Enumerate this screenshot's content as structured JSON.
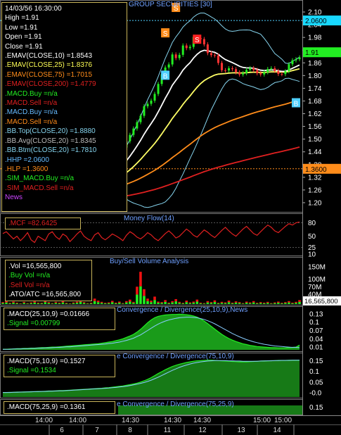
{
  "chart_data": [
    {
      "type": "candlestick",
      "title": "GROUP SECURITIES [30]",
      "ylim": [
        1.16,
        2.14
      ],
      "y_ticks": [
        "2.10",
        "2.04",
        "1.98",
        "1.92",
        "1.86",
        "1.80",
        "1.74",
        "1.68",
        "1.62",
        "1.56",
        "1.50",
        "1.44",
        "1.38",
        "1.32",
        "1.26",
        "1.20"
      ],
      "price_badges": {
        "bb_top_badge": "2.0600",
        "last_badge": "1.91",
        "hlp_badge": "1.3600"
      },
      "markers": [
        "S",
        "S",
        "S",
        "B",
        "B"
      ],
      "info": {
        "time_label": "14/03/56 16:30:00",
        "high_text": "High  =1.91",
        "low_text": "Low   =1.91",
        "open_text": "Open  =1.91",
        "close_text": "Close  =1.91",
        "ema10_text": ".EMAV(CLOSE,10)   =1.8543",
        "ema25_text": ".EMAV(CLOSE,25)  =1.8376",
        "ema75_text": ".EMAV(CLOSE,75)  =1.7015",
        "ema200_text": ".EMAV(CLOSE,200)  =1.4779",
        "macd_buy1_text": ".MACD.Buy    =n/a",
        "macd_sell1_text": ".MACD.Sell   =n/a",
        "macd_buy2_text": ".MACD.Buy    =n/a",
        "macd_sell2_text": ".MACD.Sell   =n/a",
        "bb_top_text": ".BB.Top(CLOSE,20)   =1.8880",
        "bb_avg_text": ".BB.Avg(CLOSE,20)   =1.8345",
        "bb_btm_text": ".BB.Btm(CLOSE,20)   =1.7810",
        "hhp_text": ".HHP    =2.0600",
        "hlp_text": ".HLP    =1.3600",
        "sim_buy_text": ".SIM_MACD.Buy    =n/a",
        "sim_sell_text": ".SIM_MACD.Sell    =n/a",
        "news_text": "News"
      },
      "colors": {
        "ema10": "#ffffff",
        "ema25": "#ffff66",
        "ema75": "#ff8c1a",
        "ema200": "#e02020",
        "bb": "#86d4ee",
        "candle": "#22ee22"
      }
    },
    {
      "type": "line",
      "title": "Money Flow(14)",
      "label_text": ".MCF  =82.6425",
      "ylim": [
        10,
        95
      ],
      "y_ticks": [
        "80",
        "50",
        "25",
        "10"
      ],
      "values": [
        56,
        60,
        52,
        44,
        50,
        40,
        48,
        58,
        42,
        36,
        50,
        45,
        40,
        55,
        60,
        49,
        43,
        55,
        50,
        38,
        46,
        55,
        62,
        50,
        44,
        40,
        53,
        58,
        47,
        42,
        48,
        55,
        51,
        46,
        40,
        52,
        60,
        55,
        48,
        44,
        50,
        58,
        53,
        45,
        40,
        48,
        56,
        62,
        55,
        46,
        50,
        58,
        66,
        60,
        52,
        48,
        56,
        64,
        59,
        52,
        47,
        55,
        63,
        70,
        62,
        55,
        50,
        58,
        66,
        72,
        64,
        56,
        52,
        60,
        68,
        75,
        70,
        62,
        58,
        65,
        72,
        78,
        75,
        80,
        82
      ]
    },
    {
      "type": "bar",
      "title": "Buy/Sell Volume Analysis",
      "last_value_badge": "16,565,800",
      "y_ticks": [
        "150M",
        "100M",
        "70M",
        "40M"
      ],
      "ylim": [
        0,
        170
      ],
      "info": {
        "vol_text": ".Vol    =16,565,800",
        "buy_text": ".Buy Vol   =n/a",
        "sell_text": ".Sell Vol   =n/a",
        "ato_text": ".ATO/ATC    =16,565,800"
      },
      "volumes": [
        8,
        12,
        5,
        10,
        6,
        3,
        9,
        4,
        7,
        11,
        6,
        5,
        14,
        8,
        4,
        9,
        6,
        12,
        5,
        3,
        7,
        10,
        16,
        8,
        4,
        6,
        22,
        14,
        9,
        5,
        7,
        13,
        6,
        10,
        4,
        12,
        18,
        9,
        70,
        130,
        60,
        22,
        14,
        30,
        10,
        8,
        16,
        6,
        12,
        20,
        9,
        5,
        14,
        7,
        10,
        18,
        6,
        4,
        12,
        8,
        15,
        5,
        9,
        7,
        14,
        6,
        11,
        8,
        4,
        10,
        7,
        12,
        5,
        8,
        6,
        9,
        4,
        7,
        10,
        5,
        8,
        12,
        6,
        9,
        16
      ]
    },
    {
      "type": "area",
      "title": "Convergence / Divergence(25,10,9),News",
      "ylim": [
        0,
        0.145
      ],
      "y_ticks": [
        "0.13",
        "0.1",
        "0.07",
        "0.04",
        "0.01"
      ],
      "info": {
        "macd_text": ".MACD(25,10,9)   =0.01666",
        "signal_text": ".Signal   =0.00799"
      },
      "macd": [
        0.002,
        0.002,
        0.003,
        0.003,
        0.004,
        0.004,
        0.005,
        0.005,
        0.006,
        0.006,
        0.007,
        0.008,
        0.008,
        0.009,
        0.01,
        0.01,
        0.011,
        0.012,
        0.013,
        0.014,
        0.015,
        0.016,
        0.017,
        0.018,
        0.019,
        0.02,
        0.021,
        0.022,
        0.024,
        0.026,
        0.028,
        0.03,
        0.033,
        0.036,
        0.04,
        0.045,
        0.05,
        0.056,
        0.064,
        0.074,
        0.086,
        0.098,
        0.108,
        0.116,
        0.121,
        0.124,
        0.126,
        0.127,
        0.128,
        0.128,
        0.129,
        0.128,
        0.127,
        0.125,
        0.122,
        0.118,
        0.112,
        0.104,
        0.095,
        0.085,
        0.075,
        0.065,
        0.056,
        0.048,
        0.041,
        0.035,
        0.03,
        0.026,
        0.022,
        0.019,
        0.016,
        0.014,
        0.012,
        0.011,
        0.01,
        0.009,
        0.008,
        0.008,
        0.007,
        0.007,
        0.007,
        0.008,
        0.009,
        0.01,
        0.017
      ],
      "signal": [
        0.002,
        0.002,
        0.002,
        0.003,
        0.003,
        0.003,
        0.004,
        0.004,
        0.005,
        0.005,
        0.006,
        0.006,
        0.007,
        0.007,
        0.008,
        0.009,
        0.009,
        0.01,
        0.011,
        0.011,
        0.012,
        0.013,
        0.014,
        0.015,
        0.016,
        0.017,
        0.018,
        0.019,
        0.02,
        0.021,
        0.023,
        0.024,
        0.026,
        0.028,
        0.031,
        0.034,
        0.038,
        0.042,
        0.048,
        0.054,
        0.062,
        0.07,
        0.078,
        0.086,
        0.093,
        0.099,
        0.104,
        0.108,
        0.111,
        0.114,
        0.116,
        0.117,
        0.118,
        0.118,
        0.117,
        0.116,
        0.113,
        0.11,
        0.105,
        0.1,
        0.094,
        0.087,
        0.08,
        0.073,
        0.066,
        0.059,
        0.053,
        0.047,
        0.042,
        0.037,
        0.033,
        0.029,
        0.026,
        0.023,
        0.02,
        0.018,
        0.016,
        0.014,
        0.013,
        0.012,
        0.011,
        0.01,
        0.009,
        0.009,
        0.008
      ]
    },
    {
      "type": "area",
      "title": "e Convergence / Divergence(75,10,9)",
      "ylim": [
        -0.02,
        0.175
      ],
      "y_ticks": [
        "0.15",
        "0.1",
        "0.05",
        "-0.0"
      ],
      "info": {
        "macd_text": ".MACD(75,10,9)   =0.1527",
        "signal_text": ".Signal   =0.1534"
      },
      "macd": [
        0.001,
        0.001,
        0.002,
        0.002,
        0.003,
        0.003,
        0.004,
        0.004,
        0.005,
        0.005,
        0.006,
        0.006,
        0.007,
        0.008,
        0.008,
        0.009,
        0.01,
        0.01,
        0.011,
        0.012,
        0.013,
        0.014,
        0.015,
        0.016,
        0.017,
        0.018,
        0.019,
        0.02,
        0.021,
        0.023,
        0.024,
        0.026,
        0.028,
        0.03,
        0.032,
        0.035,
        0.038,
        0.041,
        0.045,
        0.05,
        0.056,
        0.063,
        0.071,
        0.08,
        0.09,
        0.099,
        0.108,
        0.116,
        0.123,
        0.129,
        0.134,
        0.138,
        0.142,
        0.145,
        0.148,
        0.15,
        0.151,
        0.152,
        0.153,
        0.153,
        0.152,
        0.151,
        0.15,
        0.149,
        0.148,
        0.147,
        0.146,
        0.145,
        0.145,
        0.145,
        0.146,
        0.147,
        0.148,
        0.149,
        0.15,
        0.15,
        0.151,
        0.151,
        0.152,
        0.152,
        0.152,
        0.153,
        0.153,
        0.153,
        0.153
      ],
      "signal": [
        0.001,
        0.001,
        0.001,
        0.002,
        0.002,
        0.003,
        0.003,
        0.004,
        0.004,
        0.005,
        0.005,
        0.006,
        0.006,
        0.007,
        0.007,
        0.008,
        0.009,
        0.009,
        0.01,
        0.011,
        0.012,
        0.013,
        0.014,
        0.015,
        0.016,
        0.017,
        0.018,
        0.019,
        0.02,
        0.021,
        0.022,
        0.024,
        0.025,
        0.027,
        0.029,
        0.031,
        0.034,
        0.037,
        0.04,
        0.044,
        0.048,
        0.053,
        0.059,
        0.066,
        0.073,
        0.081,
        0.089,
        0.097,
        0.105,
        0.112,
        0.119,
        0.125,
        0.13,
        0.135,
        0.139,
        0.142,
        0.145,
        0.147,
        0.149,
        0.15,
        0.151,
        0.151,
        0.151,
        0.151,
        0.15,
        0.15,
        0.149,
        0.149,
        0.148,
        0.148,
        0.148,
        0.148,
        0.148,
        0.149,
        0.149,
        0.15,
        0.15,
        0.151,
        0.151,
        0.152,
        0.152,
        0.152,
        0.153,
        0.153,
        0.153
      ]
    },
    {
      "type": "area",
      "title": "e Convergence / Divergence(75,25,9)",
      "y_ticks": [
        "0.15"
      ],
      "info": {
        "macd_text": ".MACD(75,25,9)   =0.1361"
      }
    }
  ],
  "x_axis": {
    "time_labels": [
      "14:00",
      "14:00",
      "14:30",
      "14:30",
      "14:30",
      "15:00",
      "15:00"
    ],
    "day_labels": [
      "6",
      "7",
      "8",
      "11",
      "12",
      "13",
      "14"
    ]
  }
}
